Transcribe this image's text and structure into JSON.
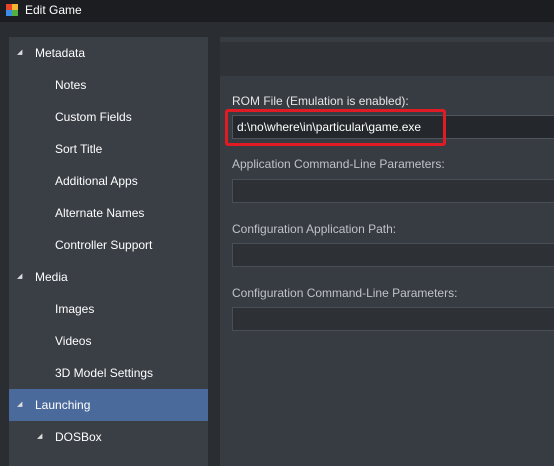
{
  "window": {
    "title": "Edit Game",
    "icon": "launchbox-app-icon"
  },
  "sidebar": {
    "items": [
      {
        "label": "Metadata",
        "level": 0,
        "expanded": true,
        "selected": false
      },
      {
        "label": "Notes",
        "level": 1,
        "selected": false
      },
      {
        "label": "Custom Fields",
        "level": 1,
        "selected": false
      },
      {
        "label": "Sort Title",
        "level": 1,
        "selected": false
      },
      {
        "label": "Additional Apps",
        "level": 1,
        "selected": false
      },
      {
        "label": "Alternate Names",
        "level": 1,
        "selected": false
      },
      {
        "label": "Controller Support",
        "level": 1,
        "selected": false
      },
      {
        "label": "Media",
        "level": 0,
        "expanded": true,
        "selected": false
      },
      {
        "label": "Images",
        "level": 1,
        "selected": false
      },
      {
        "label": "Videos",
        "level": 1,
        "selected": false
      },
      {
        "label": "3D Model Settings",
        "level": 1,
        "selected": false
      },
      {
        "label": "Launching",
        "level": 0,
        "expanded": true,
        "selected": true
      },
      {
        "label": "DOSBox",
        "level": 1,
        "expanded": true,
        "selected": false
      }
    ],
    "expand_glyph": "◢"
  },
  "form": {
    "rom_file": {
      "label": "ROM File (Emulation is enabled):",
      "value": "d:\\no\\where\\in\\particular\\game.exe"
    },
    "app_params": {
      "label": "Application Command-Line Parameters:",
      "value": ""
    },
    "config_path": {
      "label": "Configuration Application Path:",
      "value": ""
    },
    "config_params": {
      "label": "Configuration Command-Line Parameters:",
      "value": ""
    }
  },
  "colors": {
    "selected": "#4a6a9c",
    "highlight": "#e01b24",
    "sidebar_bg": "#3a3e45",
    "content_bg": "#373b42"
  }
}
